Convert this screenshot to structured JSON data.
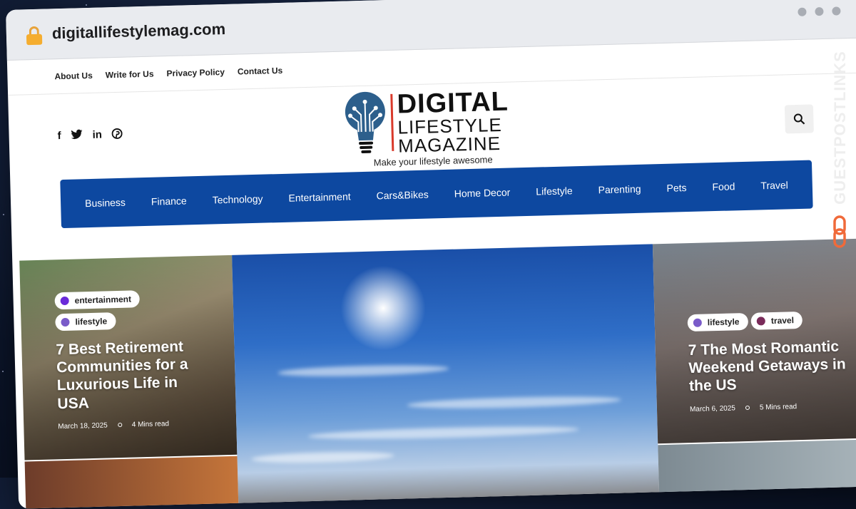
{
  "browser": {
    "url": "digitallifestylemag.com"
  },
  "topnav": [
    "About Us",
    "Write for Us",
    "Privacy Policy",
    "Contact Us"
  ],
  "social": [
    "facebook-icon",
    "twitter-icon",
    "linkedin-icon",
    "pinterest-icon"
  ],
  "logo": {
    "line1": "DIGITAL",
    "line2": "LIFESTYLE",
    "line3": "MAGAZINE"
  },
  "tagline": "Make your lifestyle awesome",
  "mainnav": [
    "Business",
    "Finance",
    "Technology",
    "Entertainment",
    "Cars&Bikes",
    "Home Decor",
    "Lifestyle",
    "Parenting",
    "Pets",
    "Food",
    "Travel"
  ],
  "cards": {
    "left": {
      "tags": [
        {
          "label": "entertainment",
          "color": "#6a2bd9"
        },
        {
          "label": "lifestyle",
          "color": "#7a5bc9"
        }
      ],
      "title": "7 Best Retirement Communities for a Luxurious Life in USA",
      "date": "March 18, 2025",
      "read": "4 Mins read"
    },
    "right": {
      "tags": [
        {
          "label": "lifestyle",
          "color": "#7a5bc9"
        },
        {
          "label": "travel",
          "color": "#7a2b5a"
        }
      ],
      "title": "7 The Most Romantic Weekend Getaways in the US",
      "date": "March 6, 2025",
      "read": "5 Mins read"
    }
  },
  "watermark": "GUESTPOSTLINKS",
  "colors": {
    "nav": "#0d48a0",
    "accent_red": "#d93a2b",
    "lock": "#f5ad2f",
    "watermark_chain": "#f06a3a"
  }
}
